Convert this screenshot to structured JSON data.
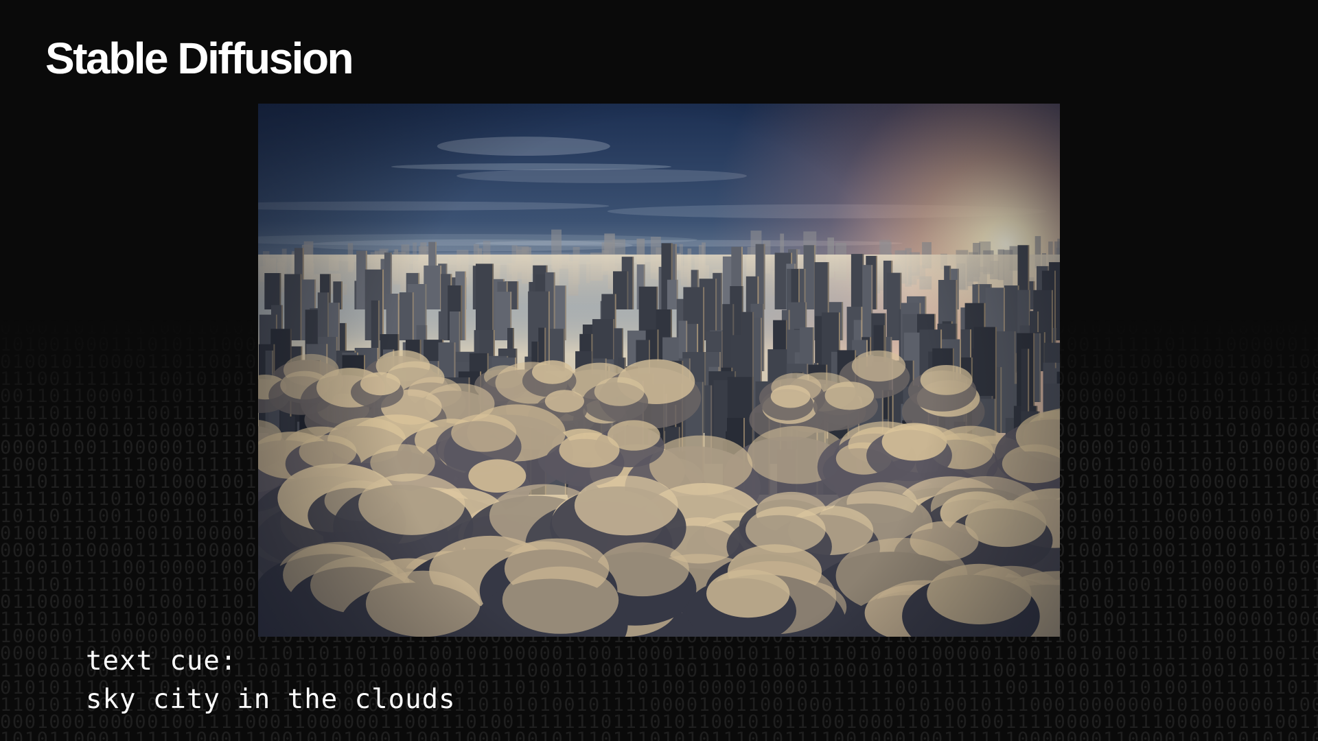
{
  "slide": {
    "title": "Stable Diffusion",
    "caption": {
      "label": "text cue:",
      "prompt": "sky city in the clouds"
    }
  },
  "image": {
    "icon": "generated-image-sky-city",
    "palette": {
      "sky_top": "#1e3357",
      "sky_mid": "#5d7595",
      "horizon": "#d9cdb8",
      "sun": "#fff2cf",
      "sun_glow": "#e9a08a",
      "cloud_light": "#d4bf98",
      "cloud_dark": "#4a4a55",
      "building": "#3a4150"
    }
  },
  "background": {
    "binary_color": "#1f1f1f"
  }
}
